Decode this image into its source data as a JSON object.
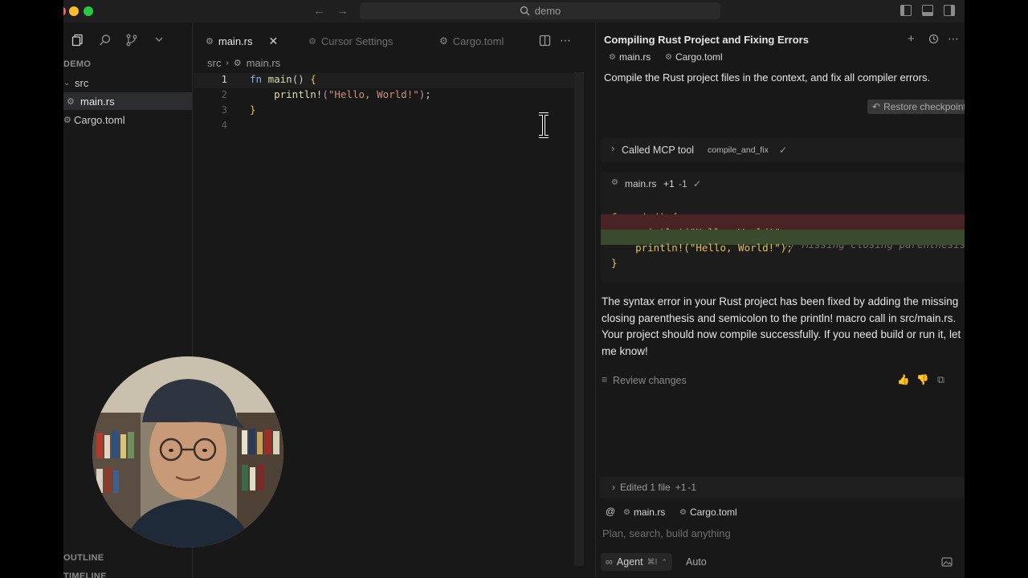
{
  "titlebar": {
    "search_text": "demo",
    "traffic_colors": [
      "#ff5f57",
      "#febc2e",
      "#28c840"
    ]
  },
  "sidebar": {
    "section_title": "DEMO",
    "tree": [
      {
        "label": "src",
        "type": "folder"
      },
      {
        "label": "main.rs",
        "type": "file",
        "selected": true
      },
      {
        "label": "Cargo.toml",
        "type": "file"
      }
    ],
    "outline_label": "OUTLINE",
    "timeline_label": "TIMELINE"
  },
  "editor": {
    "tabs": [
      {
        "label": "main.rs",
        "active": true
      },
      {
        "label": "Cursor Settings",
        "active": false
      },
      {
        "label": "Cargo.toml",
        "active": false
      }
    ],
    "breadcrumb": [
      "src",
      "main.rs"
    ],
    "lines": [
      {
        "n": "1",
        "text": "fn main() {"
      },
      {
        "n": "2",
        "text": "    println!(\"Hello, World!\");"
      },
      {
        "n": "3",
        "text": "}"
      },
      {
        "n": "4",
        "text": ""
      }
    ]
  },
  "chat": {
    "title": "Compiling Rust Project and Fixing Errors",
    "context_chips": [
      "main.rs",
      "Cargo.toml"
    ],
    "user_message": "Compile the Rust project files in the context, and fix all compiler errors.",
    "restore_label": "Restore checkpoint",
    "tool_call": {
      "label": "Called MCP tool",
      "tool_name": "compile_and_fix",
      "status": "✓"
    },
    "diff": {
      "file": "main.rs",
      "added": "+1",
      "removed": "-1",
      "status": "✓",
      "lines": [
        {
          "kind": "context",
          "code": "fn main() {",
          "comment": ""
        },
        {
          "kind": "removed",
          "code": "    println!(\"Hello, World!\"",
          "comment": " // Missing closing parenthesis"
        },
        {
          "kind": "added",
          "code": "    println!(\"Hello, World!\");",
          "comment": ""
        },
        {
          "kind": "context",
          "code": "}",
          "comment": ""
        }
      ]
    },
    "assistant_message": "The syntax error in your Rust project has been fixed by adding the missing closing parenthesis and semicolon to the println! macro call in src/main.rs. Your project should now compile successfully. If you need build or run it, let me know!",
    "review_label": "Review changes",
    "edited_summary": {
      "label": "Edited 1 file",
      "added": "+1",
      "removed": "-1"
    },
    "composer": {
      "chips": [
        "main.rs",
        "Cargo.toml"
      ],
      "placeholder": "Plan, search, build anything",
      "agent_label": "Agent",
      "agent_shortcut": "⌘I",
      "model": "Auto"
    }
  }
}
